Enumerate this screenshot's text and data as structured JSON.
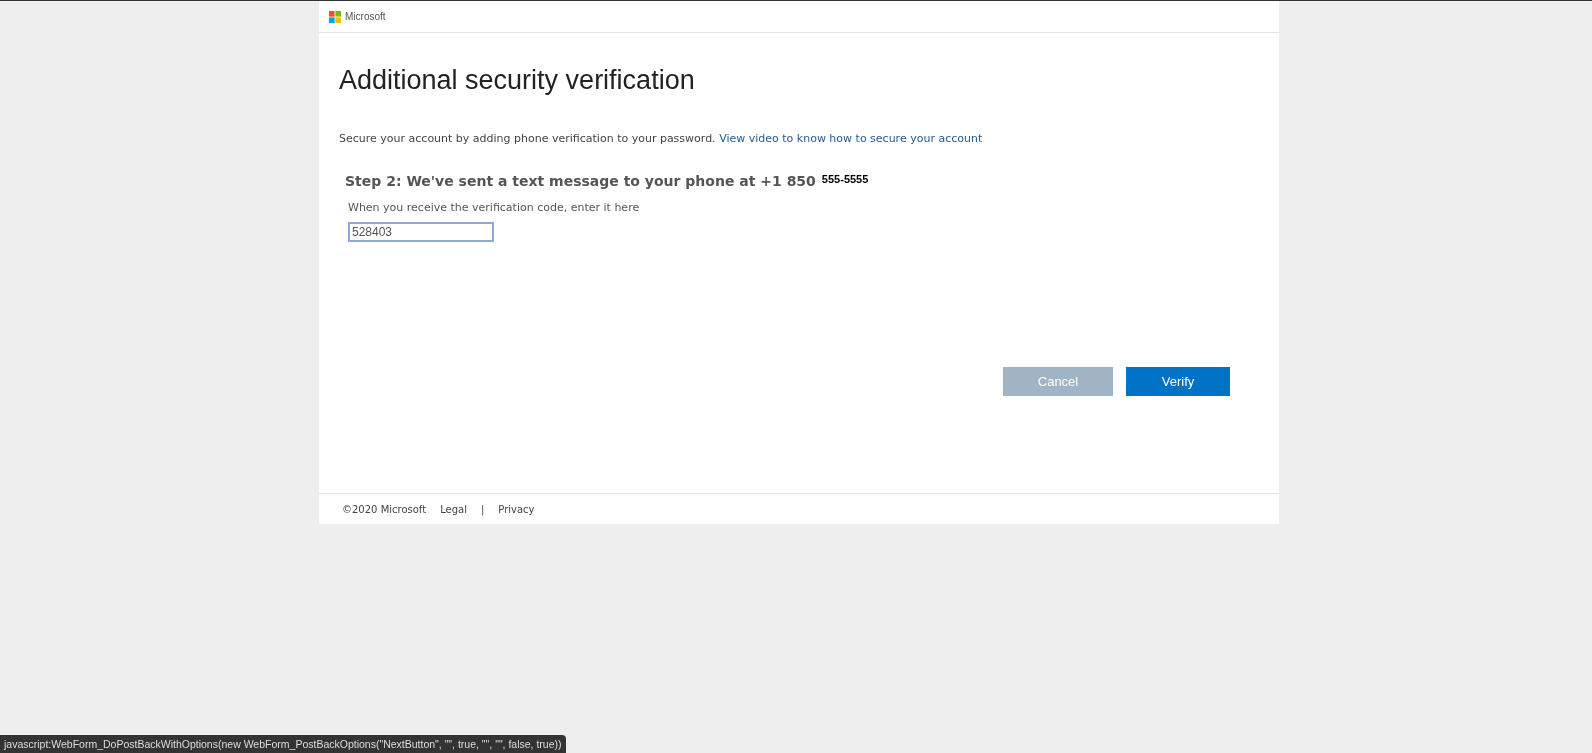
{
  "header": {
    "brand": "Microsoft"
  },
  "title": "Additional security verification",
  "intro": {
    "text": "Secure your account by adding phone verification to your password.",
    "link": "View video to know how to secure your account"
  },
  "step": {
    "heading": "Step 2: We've sent a text message to your phone at +1 850",
    "phone": "555-5555"
  },
  "code_field": {
    "label": "When you receive the verification code, enter it here",
    "value": "528403"
  },
  "buttons": [
    {
      "label": "Cancel",
      "kind": "secondary"
    },
    {
      "label": "Verify",
      "kind": "primary"
    }
  ],
  "footer": {
    "copyright": "©2020 Microsoft",
    "links": [
      "Legal",
      "Privacy"
    ],
    "separator": "|"
  },
  "status_bar": "javascript:WebForm_DoPostBackWithOptions(new WebForm_PostBackOptions(\"NextButton\", \"\", true, \"\", \"\", false, true))"
}
